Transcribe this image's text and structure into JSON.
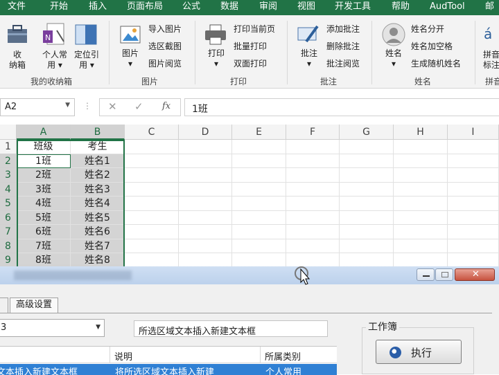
{
  "menu": [
    "文件",
    "开始",
    "插入",
    "页面布局",
    "公式",
    "数据",
    "审阅",
    "视图",
    "开发工具",
    "帮助",
    "AudTool",
    "邮"
  ],
  "ribbon": {
    "groups": [
      {
        "name": "我的收纳箱",
        "buttons": [
          "收\n纳箱",
          "个人常\n用 ▾",
          "定位引\n用 ▾"
        ]
      },
      {
        "name": "图片",
        "big": "图片\n▾",
        "items": [
          "导入图片",
          "选区截图",
          "图片阅览"
        ]
      },
      {
        "name": "打印",
        "big": "打印\n▾",
        "items": [
          "打印当前页",
          "批量打印",
          "双面打印"
        ]
      },
      {
        "name": "批注",
        "big": "批注\n▾",
        "items": [
          "添加批注",
          "删除批注",
          "批注阅览"
        ]
      },
      {
        "name": "姓名",
        "big": "姓名\n▾",
        "items": [
          "姓名分开",
          "姓名加空格",
          "生成随机姓名"
        ]
      },
      {
        "name": "拼音",
        "big": "拼音\n标注"
      }
    ]
  },
  "formula_bar": {
    "name_box": "A2",
    "fx": "fx",
    "value": "1班"
  },
  "columns": [
    "A",
    "B",
    "C",
    "D",
    "E",
    "F",
    "G",
    "H",
    "I"
  ],
  "rows": [
    "1",
    "2",
    "3",
    "4",
    "5",
    "6",
    "7",
    "8",
    "9"
  ],
  "headers": {
    "a": "班级",
    "b": "考生"
  },
  "table": [
    {
      "a": "1班",
      "b": "姓名1"
    },
    {
      "a": "2班",
      "b": "姓名2"
    },
    {
      "a": "3班",
      "b": "姓名3"
    },
    {
      "a": "4班",
      "b": "姓名4"
    },
    {
      "a": "5班",
      "b": "姓名5"
    },
    {
      "a": "6班",
      "b": "姓名6"
    },
    {
      "a": "7班",
      "b": "姓名7"
    },
    {
      "a": "8班",
      "b": "姓名8"
    }
  ],
  "dialog": {
    "tab": "高级设置",
    "combo": "3",
    "description": "所选区域文本插入新建文本框",
    "workbook_label": "工作簿",
    "run": "执行",
    "list_headers": [
      "说明",
      "所属类别"
    ],
    "list_row": [
      "文本插入新建文本框",
      "将所选区域文本插入新建",
      "个人常用"
    ]
  }
}
